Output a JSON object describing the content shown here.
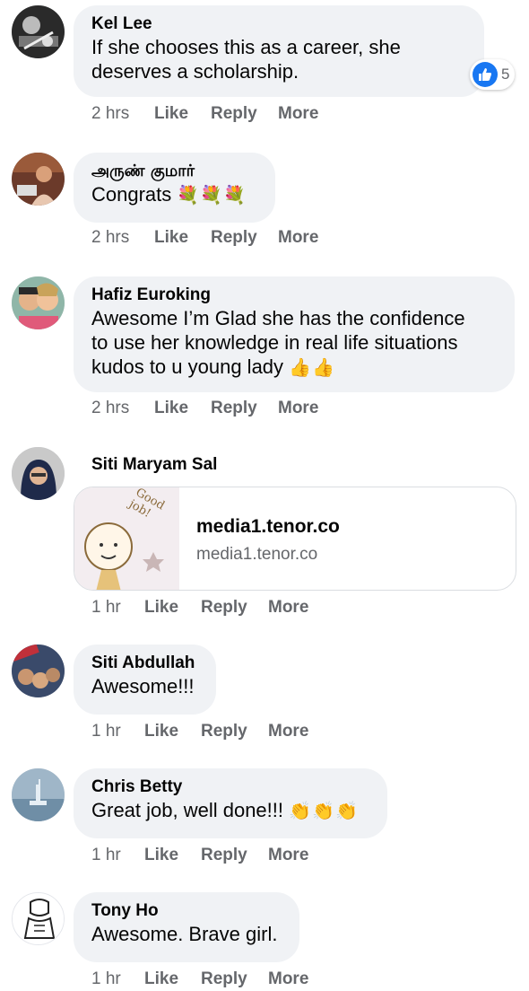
{
  "comments": [
    {
      "author": "Kel Lee",
      "text_line1": "If she chooses this as a career, she",
      "text_line2": "deserves a scholarship.",
      "time": "2 hrs",
      "like": "Like",
      "reply": "Reply",
      "more": "More",
      "reaction": {
        "type": "like",
        "count": "5",
        "color": "#1877f2"
      }
    },
    {
      "author": "அருண் குமார்",
      "text": "Congrats",
      "emoji": "💐💐💐",
      "time": "2 hrs",
      "like": "Like",
      "reply": "Reply",
      "more": "More"
    },
    {
      "author": "Hafiz Euroking",
      "text_line1": "Awesome I’m Glad she has the confidence",
      "text_line2": "to use her knowledge in real life situations",
      "text_line3": "kudos to u young lady",
      "emoji": "👍👍",
      "time": "2 hrs",
      "like": "Like",
      "reply": "Reply",
      "more": "More"
    },
    {
      "author": "Siti Maryam Sal",
      "link": {
        "title": "media1.tenor.co",
        "domain": "media1.tenor.co",
        "thumb_caption": "Good job!"
      },
      "time": "1 hr",
      "like": "Like",
      "reply": "Reply",
      "more": "More"
    },
    {
      "author": "Siti Abdullah",
      "text": "Awesome!!!",
      "time": "1 hr",
      "like": "Like",
      "reply": "Reply",
      "more": "More"
    },
    {
      "author": "Chris Betty",
      "text": "Great job, well done!!!",
      "emoji": "👏👏👏",
      "time": "1 hr",
      "like": "Like",
      "reply": "Reply",
      "more": "More"
    },
    {
      "author": "Tony Ho",
      "text": "Awesome. Brave girl.",
      "time": "1 hr",
      "like": "Like",
      "reply": "Reply",
      "more": "More"
    }
  ],
  "icons": {
    "reaction": "like-thumbs-up-icon",
    "avatars": [
      "avatar-dj",
      "avatar-singer",
      "avatar-couple-cartoon",
      "avatar-hijab",
      "avatar-group",
      "avatar-statue",
      "avatar-sketch"
    ]
  }
}
